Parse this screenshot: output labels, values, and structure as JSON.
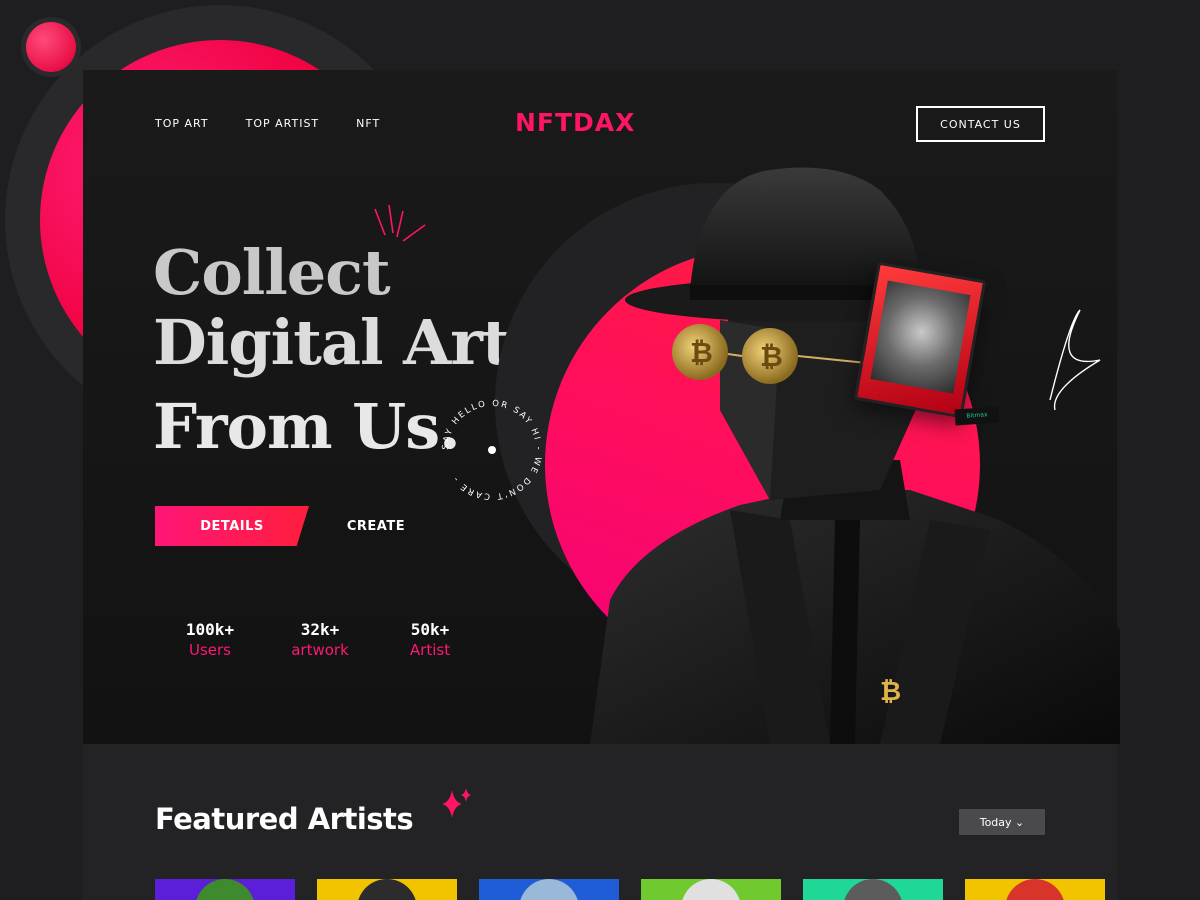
{
  "nav": {
    "items": [
      "TOP ART",
      "TOP ARTIST",
      "NFT"
    ],
    "logo": "NFTDAX",
    "contact_label": "CONTACT US"
  },
  "hero": {
    "headline": [
      "Collect",
      "Digital Art",
      "From Us."
    ],
    "details_label": "DETAILS",
    "create_label": "CREATE",
    "rotating_text": "SAY HELLO OR SAY HI - WE DON'T CARE -",
    "card_tag": "Bitmax"
  },
  "stats": [
    {
      "value": "100k+",
      "label": "Users"
    },
    {
      "value": "32k+",
      "label": "artwork"
    },
    {
      "value": "50k+",
      "label": "Artist"
    }
  ],
  "featured": {
    "title": "Featured Artists",
    "filter_label": "Today",
    "thumbnails": [
      {
        "color": "#5b1fd8",
        "obj": "#3e8a2e"
      },
      {
        "color": "#f2c400",
        "obj": "#2c2c2c"
      },
      {
        "color": "#1f5cd8",
        "obj": "#9ab8d8"
      },
      {
        "color": "#6fc92f",
        "obj": "#e0e0e0"
      },
      {
        "color": "#1fd896",
        "obj": "#5c5c5c"
      },
      {
        "color": "#f2c400",
        "obj": "#d8342b"
      }
    ]
  },
  "colors": {
    "accent": "#ff1561",
    "bg": "#1e1e20"
  },
  "icons": [
    "sparkle-icon",
    "chevron-down-icon",
    "bitcoin-glasses",
    "bitcoin-pin"
  ]
}
